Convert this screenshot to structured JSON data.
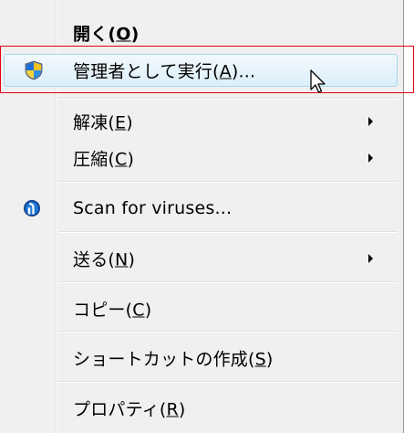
{
  "menu": {
    "items": [
      {
        "label_pre": "開く(",
        "key": "O",
        "label_post": ")",
        "bold": true
      },
      {
        "label_pre": "管理者として実行(",
        "key": "A",
        "label_post": ")...",
        "icon": "uac-shield-icon"
      },
      {
        "label_pre": "解凍(",
        "key": "E",
        "label_post": ")",
        "submenu": true
      },
      {
        "label_pre": "圧縮(",
        "key": "C",
        "label_post": ")",
        "submenu": true
      },
      {
        "label": "Scan for viruses...",
        "icon": "antivirus-scan-icon"
      },
      {
        "label_pre": "送る(",
        "key": "N",
        "label_post": ")",
        "submenu": true
      },
      {
        "label_pre": "コピー(",
        "key": "C",
        "label_post": ")"
      },
      {
        "label_pre": "ショートカットの作成(",
        "key": "S",
        "label_post": ")"
      },
      {
        "label_pre": "プロパティ(",
        "key": "R",
        "label_post": ")"
      }
    ],
    "hovered_index": 1
  },
  "colors": {
    "menu_bg": "#f0f0f0",
    "highlight_border": "#e60012",
    "hover_border": "#a8d8eb"
  }
}
